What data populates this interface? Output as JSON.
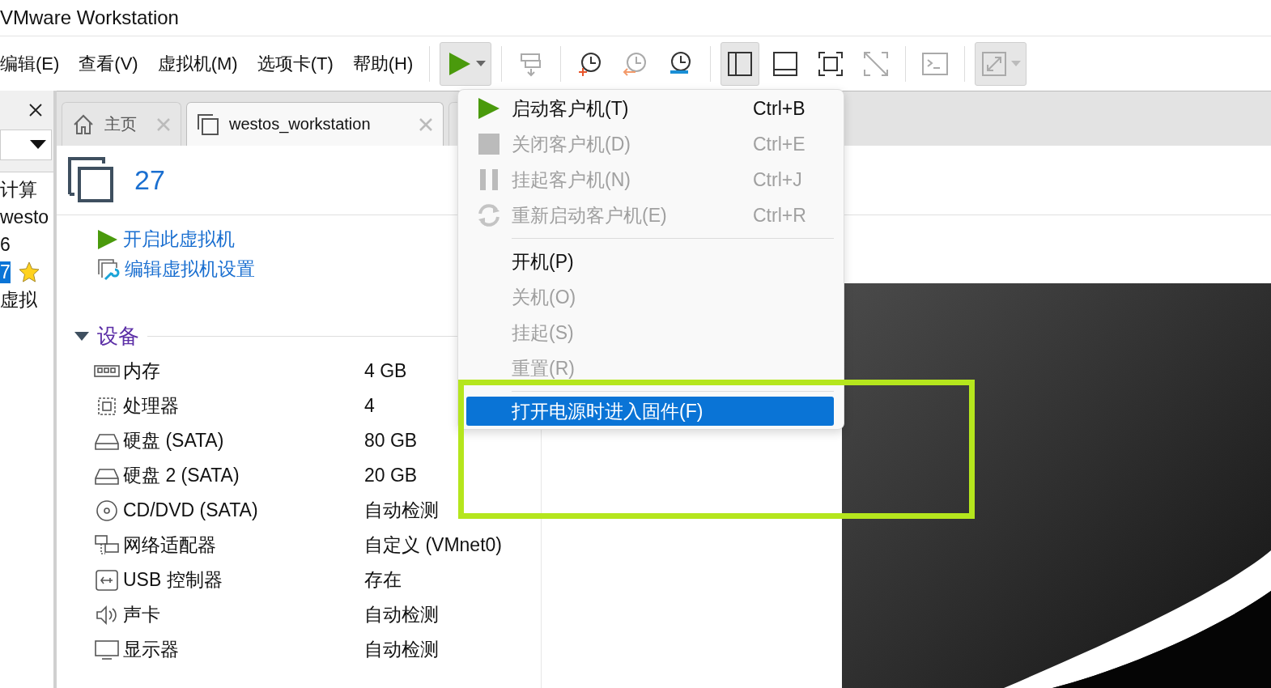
{
  "window": {
    "title": "VMware Workstation"
  },
  "menu_bar": [
    "编辑(E)",
    "查看(V)",
    "虚拟机(M)",
    "选项卡(T)",
    "帮助(H)"
  ],
  "toolbar": [
    {
      "kind": "play",
      "pressed": true,
      "disabled": false,
      "dropdown": true
    },
    {
      "kind": "sep"
    },
    {
      "kind": "send-keys",
      "pressed": false,
      "disabled": true,
      "dropdown": false
    },
    {
      "kind": "sep"
    },
    {
      "kind": "snapshot-take",
      "pressed": false,
      "disabled": false,
      "dropdown": false
    },
    {
      "kind": "snapshot-revert",
      "pressed": false,
      "disabled": true,
      "dropdown": false
    },
    {
      "kind": "snapshot-manager",
      "pressed": false,
      "disabled": false,
      "dropdown": false
    },
    {
      "kind": "sep"
    },
    {
      "kind": "view-sidebar",
      "pressed": true,
      "disabled": false,
      "dropdown": false
    },
    {
      "kind": "view-bottom",
      "pressed": false,
      "disabled": false,
      "dropdown": false
    },
    {
      "kind": "fullscreen",
      "pressed": false,
      "disabled": false,
      "dropdown": false
    },
    {
      "kind": "unity",
      "pressed": false,
      "disabled": true,
      "dropdown": false
    },
    {
      "kind": "sep"
    },
    {
      "kind": "console",
      "pressed": false,
      "disabled": true,
      "dropdown": false
    },
    {
      "kind": "sep"
    },
    {
      "kind": "stretch",
      "pressed": true,
      "disabled": true,
      "dropdown": true
    }
  ],
  "sidebar": {
    "items": [
      {
        "label": "计算",
        "selected": false,
        "starred": false
      },
      {
        "label": "westo",
        "selected": false,
        "starred": false
      },
      {
        "label": "6",
        "selected": false,
        "starred": false
      },
      {
        "label": "7",
        "selected": true,
        "starred": true
      },
      {
        "label": "虚拟",
        "selected": false,
        "starred": false
      }
    ]
  },
  "tabs": [
    {
      "label": "主页",
      "kind": "home",
      "selected": false
    },
    {
      "label": "westos_workstation",
      "kind": "vm",
      "selected": true
    }
  ],
  "vm": {
    "name": "27",
    "actions": [
      {
        "kind": "power-on",
        "label": "开启此虚拟机"
      },
      {
        "kind": "edit",
        "label": "编辑虚拟机设置"
      }
    ],
    "devices_heading": "设备",
    "devices": [
      {
        "kind": "memory",
        "name": "内存",
        "value": "4 GB"
      },
      {
        "kind": "cpu",
        "name": "处理器",
        "value": "4"
      },
      {
        "kind": "disk",
        "name": "硬盘 (SATA)",
        "value": "80 GB"
      },
      {
        "kind": "disk",
        "name": "硬盘 2 (SATA)",
        "value": "20 GB"
      },
      {
        "kind": "cdrom",
        "name": "CD/DVD (SATA)",
        "value": "自动检测"
      },
      {
        "kind": "network",
        "name": "网络适配器",
        "value": "自定义 (VMnet0)"
      },
      {
        "kind": "usb",
        "name": "USB 控制器",
        "value": "存在"
      },
      {
        "kind": "sound",
        "name": "声卡",
        "value": "自动检测"
      },
      {
        "kind": "display",
        "name": "显示器",
        "value": "自动检测"
      }
    ]
  },
  "power_menu": [
    {
      "kind": "start",
      "label": "启动客户机(T)",
      "shortcut": "Ctrl+B",
      "disabled": false,
      "selected": false
    },
    {
      "kind": "shutdown",
      "label": "关闭客户机(D)",
      "shortcut": "Ctrl+E",
      "disabled": true,
      "selected": false
    },
    {
      "kind": "suspend",
      "label": "挂起客户机(N)",
      "shortcut": "Ctrl+J",
      "disabled": true,
      "selected": false
    },
    {
      "kind": "restart",
      "label": "重新启动客户机(E)",
      "shortcut": "Ctrl+R",
      "disabled": true,
      "selected": false
    },
    {
      "kind": "separator"
    },
    {
      "kind": "item",
      "label": "开机(P)",
      "disabled": false,
      "selected": false
    },
    {
      "kind": "item",
      "label": "关机(O)",
      "disabled": true,
      "selected": false
    },
    {
      "kind": "item",
      "label": "挂起(S)",
      "disabled": true,
      "selected": false
    },
    {
      "kind": "item",
      "label": "重置(R)",
      "disabled": true,
      "selected": false
    },
    {
      "kind": "separator"
    },
    {
      "kind": "item",
      "label": "打开电源时进入固件(F)",
      "disabled": false,
      "selected": true
    }
  ]
}
